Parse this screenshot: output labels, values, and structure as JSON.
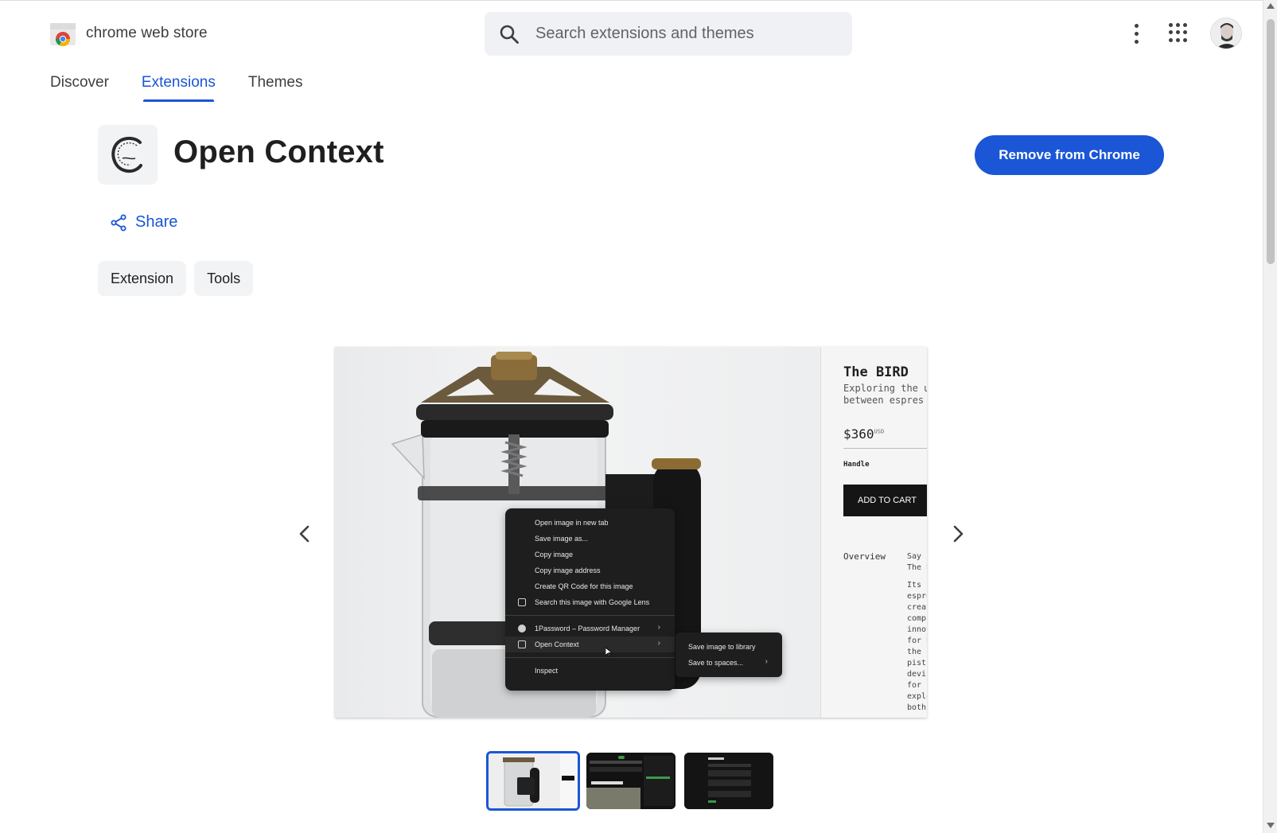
{
  "header": {
    "logo_text": "chrome web store",
    "search_placeholder": "Search extensions and themes",
    "icons": [
      "chrome-logo-icon",
      "search-icon",
      "more-vert-icon",
      "apps-grid-icon",
      "avatar"
    ]
  },
  "nav": {
    "tabs": [
      {
        "label": "Discover",
        "active": false
      },
      {
        "label": "Extensions",
        "active": true
      },
      {
        "label": "Themes",
        "active": false
      }
    ]
  },
  "extension": {
    "name": "Open Context",
    "action_label": "Remove from Chrome",
    "share_label": "Share",
    "chips": [
      "Extension",
      "Tools"
    ]
  },
  "screenshot": {
    "product_title": "The BIRD",
    "product_sub_1": "Exploring the ur",
    "product_sub_2": "between espres",
    "price": "$360",
    "price_currency": "USD",
    "handle_label": "Handle",
    "cart_label": "ADD TO CART",
    "overview_label": "Overview",
    "overview_text": [
      "Say h",
      "The B",
      "",
      "Its ur",
      "espre",
      "creat",
      "comp",
      "innov",
      "for B",
      "the f",
      "pistc",
      "devic",
      "for b",
      "explo",
      "both"
    ],
    "context_menu": [
      {
        "label": "Open image in new tab"
      },
      {
        "label": "Save image as..."
      },
      {
        "label": "Copy image"
      },
      {
        "label": "Copy image address"
      },
      {
        "label": "Create QR Code for this image"
      },
      {
        "label": "Search this image with Google Lens"
      },
      {
        "label": "1Password – Password Manager"
      },
      {
        "label": "Open Context"
      },
      {
        "label": "Inspect"
      }
    ],
    "submenu": [
      {
        "label": "Save image to library"
      },
      {
        "label": "Save to spaces..."
      }
    ]
  },
  "thumbnails": {
    "count": 3,
    "selected_index": 0
  },
  "colors": {
    "accent": "#1a56d6",
    "chip_bg": "#f1f3f4",
    "search_bg": "#eff1f5"
  }
}
